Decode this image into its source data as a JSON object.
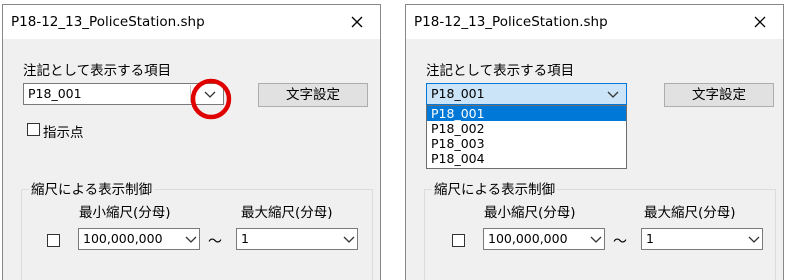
{
  "dialog": {
    "title": "P18-12_13_PoliceStation.shp",
    "annotation_label": "注記として表示する項目",
    "field_value": "P18_001",
    "font_button": "文字設定",
    "point_checkbox_label": "指示点",
    "point_checkbox_checked": false,
    "scale_group_label": "縮尺による表示制御",
    "scale_enabled_checked": false,
    "min_scale_label": "最小縮尺(分母)",
    "max_scale_label": "最大縮尺(分母)",
    "min_scale_value": "100,000,000",
    "max_scale_value": "1",
    "range_separator": "～"
  },
  "dropdown_options": [
    "P18_001",
    "P18_002",
    "P18_003",
    "P18_004"
  ],
  "dropdown_selected_index": 0,
  "colors": {
    "dialog_bg": "#f0f0f0",
    "selection": "#0078d7",
    "highlight_circle": "#e00000"
  },
  "icons": [
    "close-icon",
    "chevron-down-icon",
    "highlight-circle"
  ]
}
